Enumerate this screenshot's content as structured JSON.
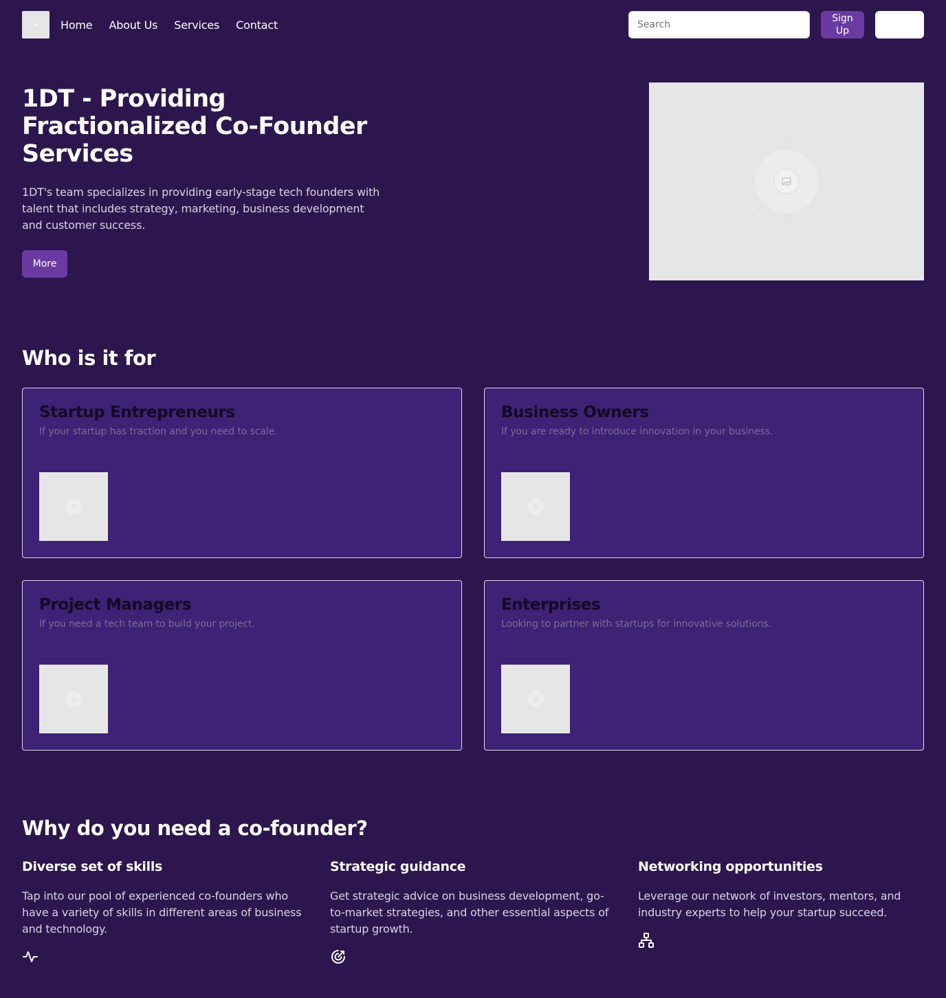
{
  "nav": {
    "links": [
      "Home",
      "About Us",
      "Services",
      "Contact"
    ],
    "search_placeholder": "Search",
    "signup_label": "Sign Up"
  },
  "hero": {
    "title": "1DT - Providing Fractionalized Co-Founder Services",
    "description": "1DT's team specializes in providing early-stage tech founders with talent that includes strategy, marketing, business development and customer success.",
    "more_label": "More"
  },
  "who": {
    "title": "Who is it for",
    "cards": [
      {
        "title": "Startup Entrepreneurs",
        "desc": "If your startup has traction and you need to scale."
      },
      {
        "title": "Business Owners",
        "desc": "If you are ready to introduce innovation in your business."
      },
      {
        "title": "Project Managers",
        "desc": "If you need a tech team to build your project."
      },
      {
        "title": "Enterprises",
        "desc": "Looking to partner with startups for innovative solutions."
      }
    ]
  },
  "why": {
    "title": "Why do you need a co-founder?",
    "features": [
      {
        "title": "Diverse set of skills",
        "desc": "Tap into our pool of experienced co-founders who have a variety of skills in different areas of business and technology.",
        "icon": "activity-icon"
      },
      {
        "title": "Strategic guidance",
        "desc": "Get strategic advice on business development, go-to-market strategies, and other essential aspects of startup growth.",
        "icon": "target-arrow-icon"
      },
      {
        "title": "Networking opportunities",
        "desc": "Leverage our network of investors, mentors, and industry experts to help your startup succeed.",
        "icon": "network-icon"
      }
    ]
  },
  "colors": {
    "background": "#2c164d",
    "card": "#3d2275",
    "accent": "#6a3aa2"
  }
}
